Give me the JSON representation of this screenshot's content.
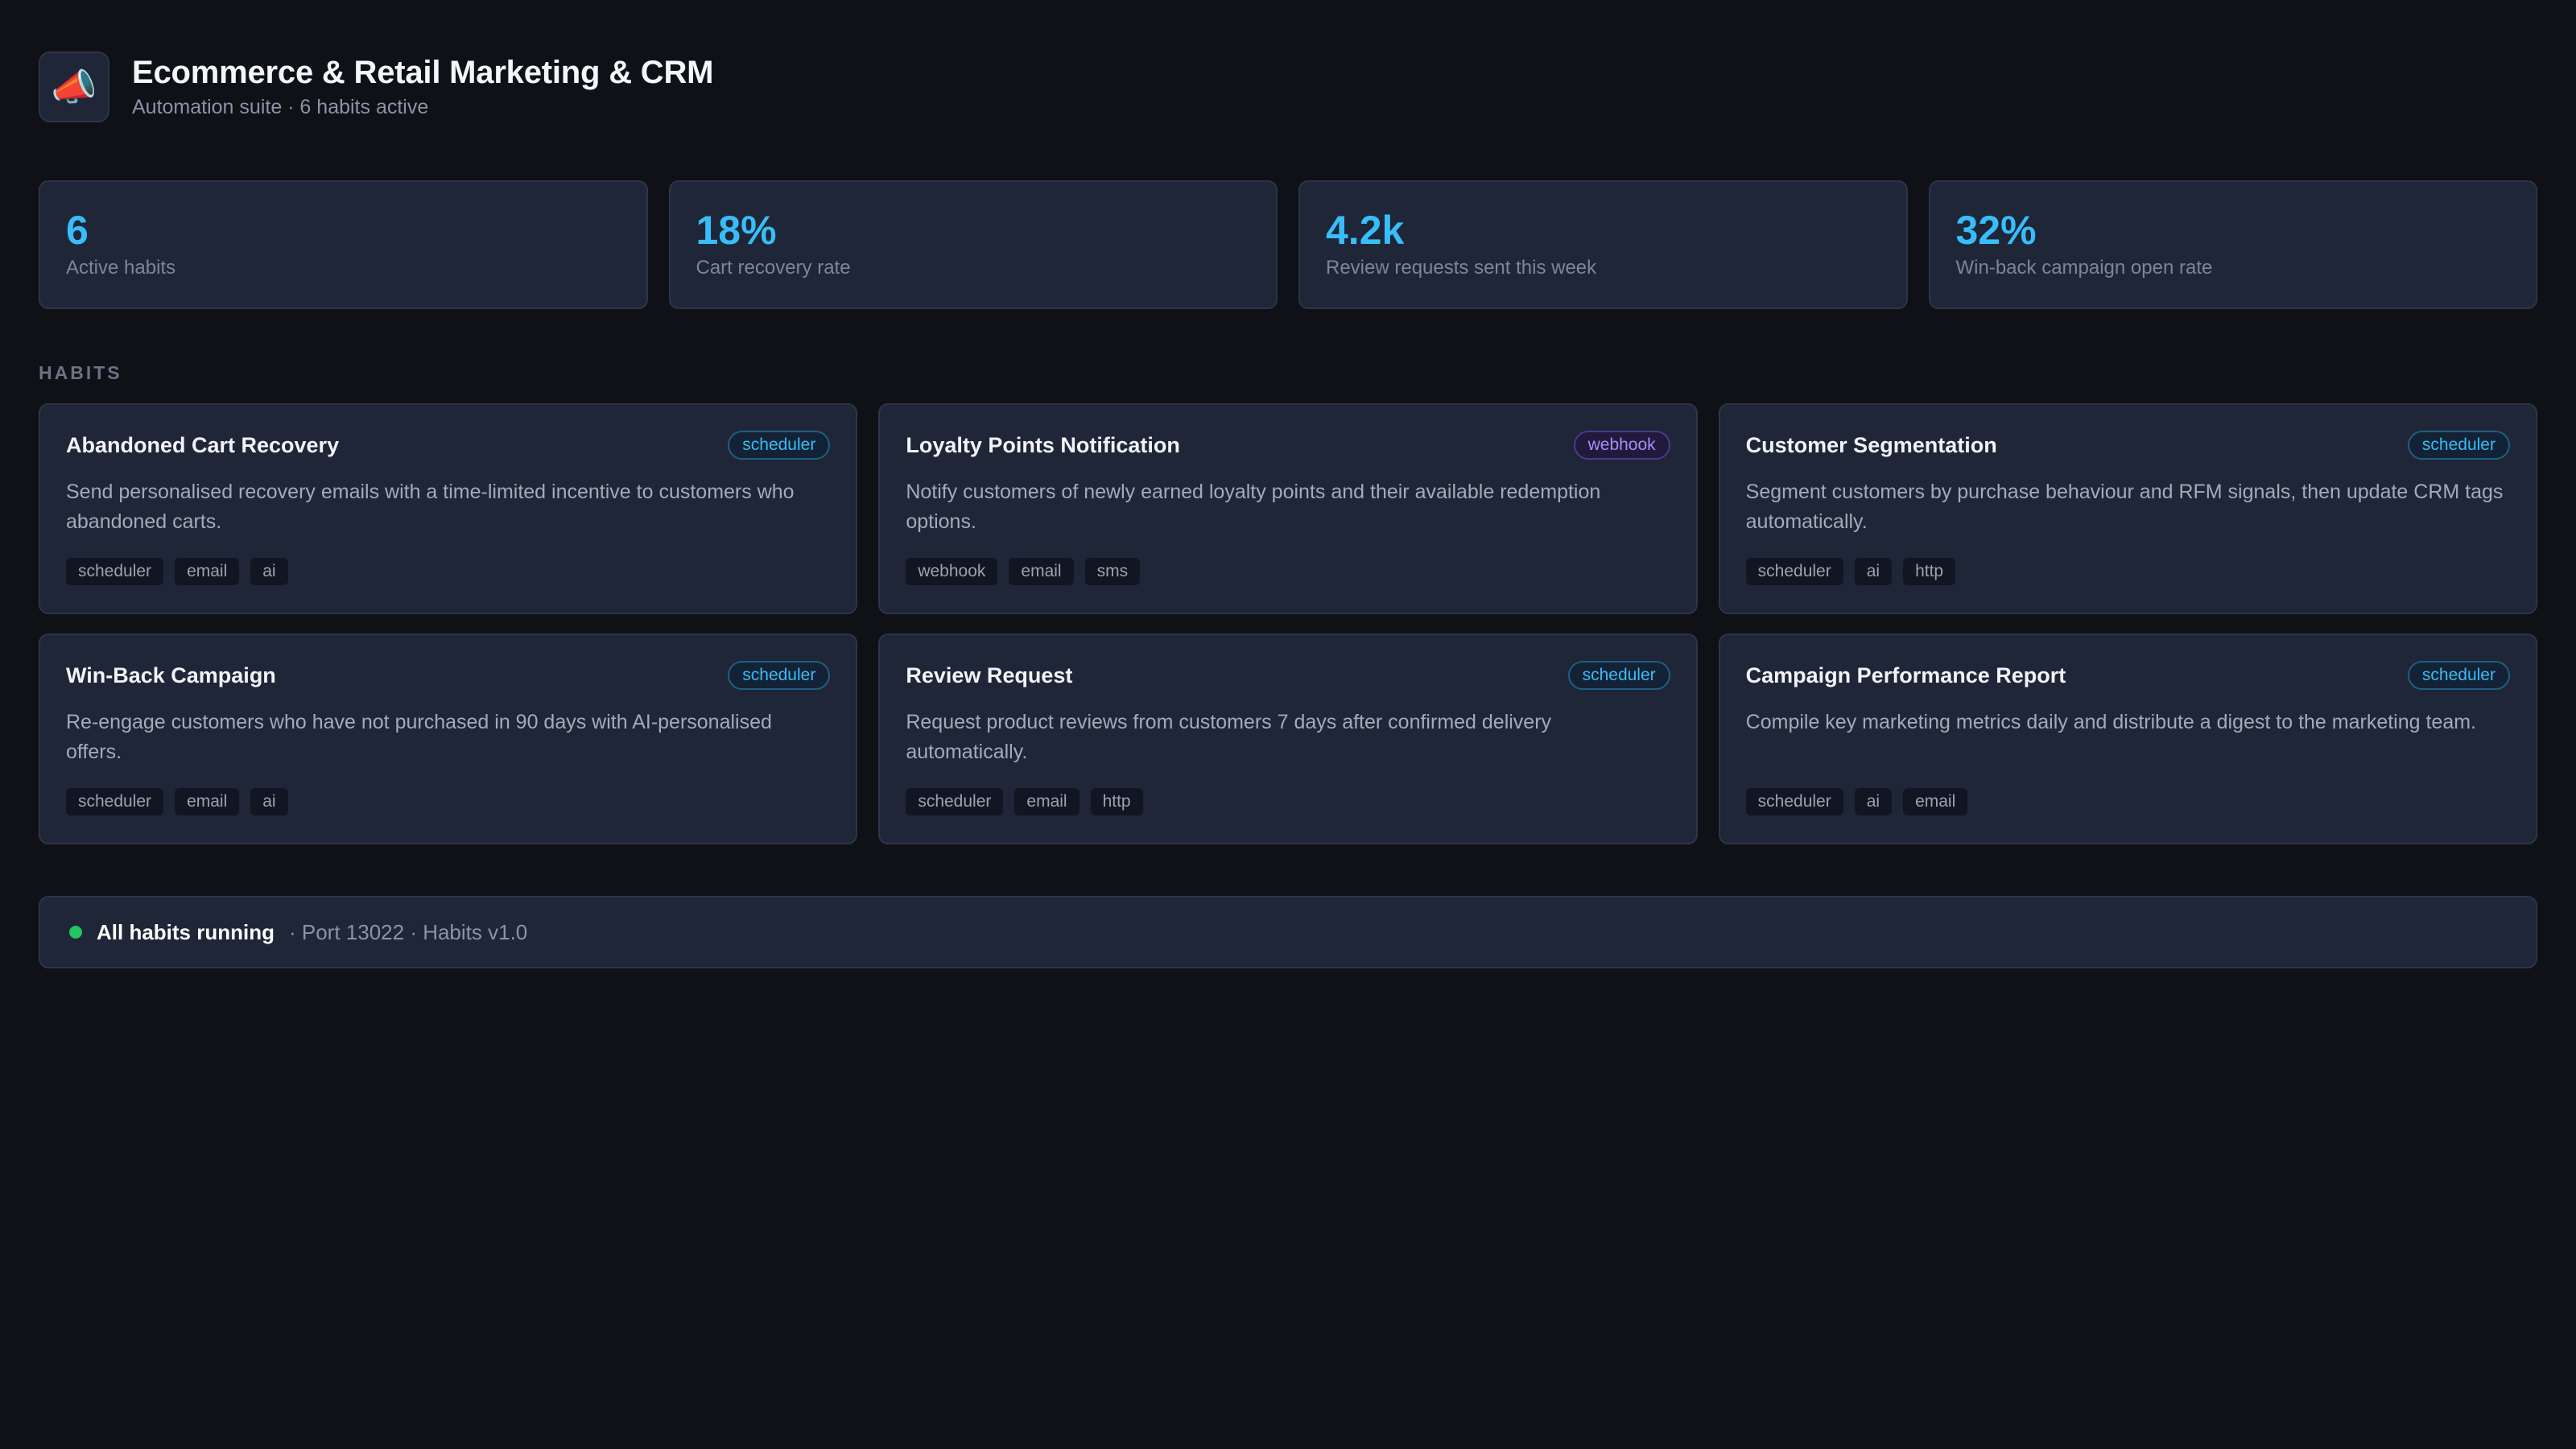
{
  "header": {
    "icon": "megaphone-icon",
    "icon_glyph": "📣",
    "title": "Ecommerce & Retail Marketing & CRM",
    "subtitle": "Automation suite · 6 habits active"
  },
  "stats": [
    {
      "value": "6",
      "label": "Active habits"
    },
    {
      "value": "18%",
      "label": "Cart recovery rate"
    },
    {
      "value": "4.2k",
      "label": "Review requests sent this week"
    },
    {
      "value": "32%",
      "label": "Win-back campaign open rate"
    }
  ],
  "section_label": "HABITS",
  "habits": [
    {
      "name": "Abandoned Cart Recovery",
      "trigger": "scheduler",
      "description": "Send personalised recovery emails with a time-limited incentive to customers who abandoned carts.",
      "tags": [
        "scheduler",
        "email",
        "ai"
      ]
    },
    {
      "name": "Loyalty Points Notification",
      "trigger": "webhook",
      "description": "Notify customers of newly earned loyalty points and their available redemption options.",
      "tags": [
        "webhook",
        "email",
        "sms"
      ]
    },
    {
      "name": "Customer Segmentation",
      "trigger": "scheduler",
      "description": "Segment customers by purchase behaviour and RFM signals, then update CRM tags automatically.",
      "tags": [
        "scheduler",
        "ai",
        "http"
      ]
    },
    {
      "name": "Win-Back Campaign",
      "trigger": "scheduler",
      "description": "Re-engage customers who have not purchased in 90 days with AI-personalised offers.",
      "tags": [
        "scheduler",
        "email",
        "ai"
      ]
    },
    {
      "name": "Review Request",
      "trigger": "scheduler",
      "description": "Request product reviews from customers 7 days after confirmed delivery automatically.",
      "tags": [
        "scheduler",
        "email",
        "http"
      ]
    },
    {
      "name": "Campaign Performance Report",
      "trigger": "scheduler",
      "description": "Compile key marketing metrics daily and distribute a digest to the marketing team.",
      "tags": [
        "scheduler",
        "ai",
        "email"
      ]
    }
  ],
  "status": {
    "headline": "All habits running",
    "detail": "· Port 13022 · Habits v1.0",
    "dot_color": "#22c55e"
  },
  "colors": {
    "background": "#0f1117",
    "card": "#1e2638",
    "accent": "#38bdf8",
    "webhook_accent": "#a78bfa"
  }
}
